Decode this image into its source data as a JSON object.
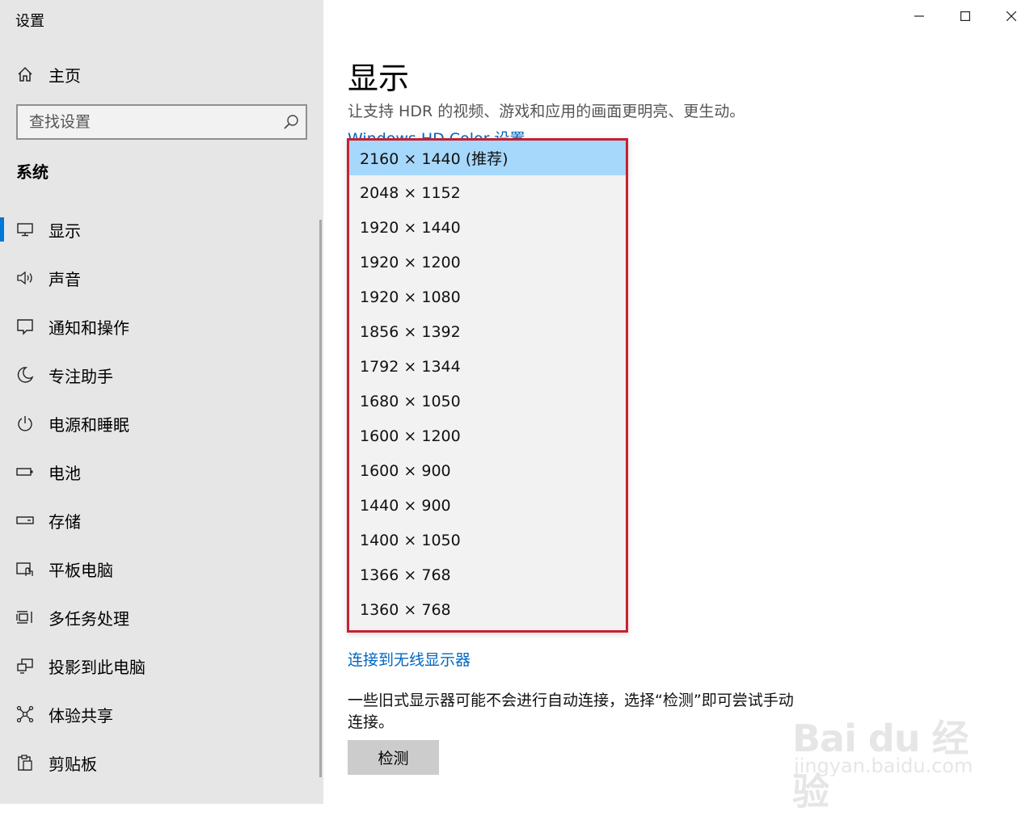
{
  "window": {
    "title": "设置"
  },
  "sidebar": {
    "home_label": "主页",
    "search_placeholder": "查找设置",
    "section_title": "系统",
    "items": [
      {
        "label": "显示",
        "icon": "monitor-icon",
        "active": true
      },
      {
        "label": "声音",
        "icon": "speaker-icon"
      },
      {
        "label": "通知和操作",
        "icon": "notification-icon"
      },
      {
        "label": "专注助手",
        "icon": "moon-icon"
      },
      {
        "label": "电源和睡眠",
        "icon": "power-icon"
      },
      {
        "label": "电池",
        "icon": "battery-icon"
      },
      {
        "label": "存储",
        "icon": "storage-icon"
      },
      {
        "label": "平板电脑",
        "icon": "tablet-icon"
      },
      {
        "label": "多任务处理",
        "icon": "multitask-icon"
      },
      {
        "label": "投影到此电脑",
        "icon": "project-icon"
      },
      {
        "label": "体验共享",
        "icon": "share-icon"
      },
      {
        "label": "剪贴板",
        "icon": "clipboard-icon"
      }
    ]
  },
  "main": {
    "title": "显示",
    "hdr_description": "让支持 HDR 的视频、游戏和应用的画面更明亮、更生动。",
    "hdr_link": "Windows HD Color 设置",
    "resolution_options": [
      "2160 × 1440 (推荐)",
      "2048 × 1152",
      "1920 × 1440",
      "1920 × 1200",
      "1920 × 1080",
      "1856 × 1392",
      "1792 × 1344",
      "1680 × 1050",
      "1600 × 1200",
      "1600 × 900",
      "1440 × 900",
      "1400 × 1050",
      "1366 × 768",
      "1360 × 768"
    ],
    "selected_resolution": "2160 × 1440 (推荐)",
    "wireless_link": "连接到无线显示器",
    "detect_note": "一些旧式显示器可能不会进行自动连接，选择“检测”即可尝试手动连接。",
    "detect_button": "检测"
  },
  "watermark": {
    "brand": "Bai du 经验",
    "url": "jingyan.baidu.com"
  },
  "colors": {
    "sidebar_bg": "#e6e6e6",
    "accent": "#0078d7",
    "link": "#0067c0",
    "selected_option": "#a6d8fc",
    "highlight_border": "#c8202f"
  }
}
